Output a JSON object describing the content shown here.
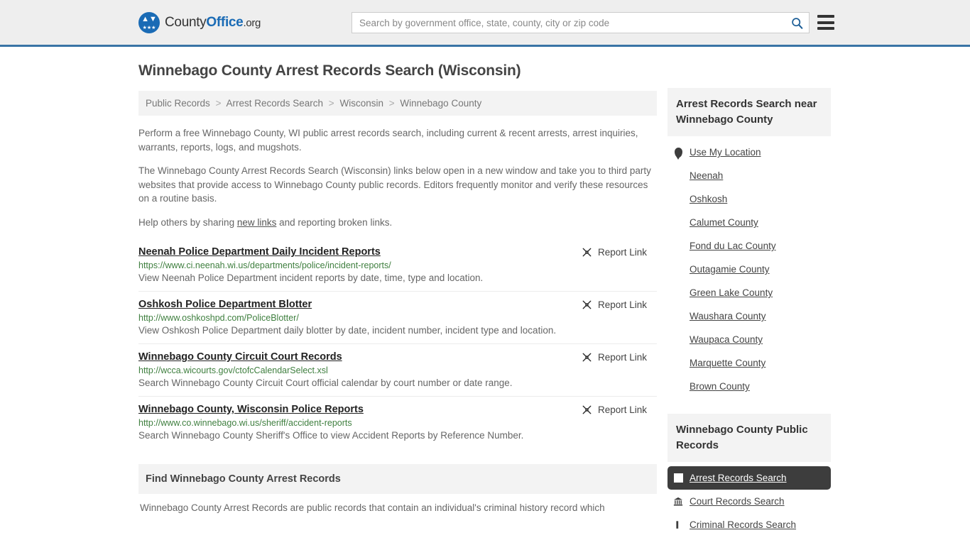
{
  "header": {
    "logo": {
      "part1": "County",
      "part2": "Office",
      "part3": ".org",
      "eagle_icon": "eagle-icon",
      "stars_icon": "stars-icon"
    },
    "search": {
      "placeholder": "Search by government office, state, county, city or zip code",
      "value": "",
      "search_icon": "search-icon"
    },
    "menu_icon": "hamburger-menu-icon",
    "accent_color": "#3a74a5",
    "background_color": "#eeeeee"
  },
  "main": {
    "title": "Winnebago County Arrest Records Search (Wisconsin)",
    "breadcrumb": [
      "Public Records",
      "Arrest Records Search",
      "Wisconsin",
      "Winnebago County"
    ],
    "breadcrumb_separator": ">",
    "paragraphs": {
      "p1": "Perform a free Winnebago County, WI public arrest records search, including current & recent arrests, arrest inquiries, warrants, reports, logs, and mugshots.",
      "p2": "The Winnebago County Arrest Records Search (Wisconsin) links below open in a new window and take you to third party websites that provide access to Winnebago County public records. Editors frequently monitor and verify these resources on a routine basis.",
      "p3_before": "Help others by sharing ",
      "p3_link": "new links",
      "p3_after": " and reporting broken links."
    },
    "report_link_label": "Report Link",
    "report_link_icon": "broken-link-icon",
    "results": [
      {
        "title": "Neenah Police Department Daily Incident Reports",
        "url": "https://www.ci.neenah.wi.us/departments/police/incident-reports/",
        "description": "View Neenah Police Department incident reports by date, time, type and location."
      },
      {
        "title": "Oshkosh Police Department Blotter",
        "url": "http://www.oshkoshpd.com/PoliceBlotter/",
        "description": "View Oshkosh Police Department daily blotter by date, incident number, incident type and location."
      },
      {
        "title": "Winnebago County Circuit Court Records",
        "url": "http://wcca.wicourts.gov/ctofcCalendarSelect.xsl",
        "description": "Search Winnebago County Circuit Court official calendar by court number or date range."
      },
      {
        "title": "Winnebago County, Wisconsin Police Reports",
        "url": "http://www.co.winnebago.wi.us/sheriff/accident-reports",
        "description": "Search Winnebago County Sheriff's Office to view Accident Reports by Reference Number."
      }
    ],
    "find_section": {
      "heading": "Find Winnebago County Arrest Records",
      "body": "Winnebago County Arrest Records are public records that contain an individual's criminal history record which"
    }
  },
  "sidebar": {
    "nearby": {
      "heading": "Arrest Records Search near Winnebago County",
      "items": [
        {
          "label": "Use My Location",
          "icon": "map-pin-icon"
        },
        {
          "label": "Neenah",
          "icon": ""
        },
        {
          "label": "Oshkosh",
          "icon": ""
        },
        {
          "label": "Calumet County",
          "icon": ""
        },
        {
          "label": "Fond du Lac County",
          "icon": ""
        },
        {
          "label": "Outagamie County",
          "icon": ""
        },
        {
          "label": "Green Lake County",
          "icon": ""
        },
        {
          "label": "Waushara County",
          "icon": ""
        },
        {
          "label": "Waupaca County",
          "icon": ""
        },
        {
          "label": "Marquette County",
          "icon": ""
        },
        {
          "label": "Brown County",
          "icon": ""
        }
      ]
    },
    "public_records": {
      "heading": "Winnebago County Public Records",
      "items": [
        {
          "label": "Arrest Records Search",
          "icon": "white-square-icon",
          "active": true
        },
        {
          "label": "Court Records Search",
          "icon": "courthouse-icon",
          "active": false
        },
        {
          "label": "Criminal Records Search",
          "icon": "document-icon",
          "active": false
        }
      ]
    }
  }
}
